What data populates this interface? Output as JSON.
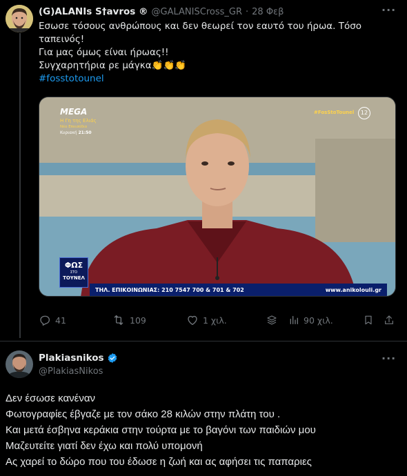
{
  "tweet1": {
    "author_name": "(G)ALANIs S†avros ®",
    "handle": "@GALANISCross_GR",
    "separator": "·",
    "date": "28 Φεβ",
    "more_label": "···",
    "lines": [
      "Εσωσε τόσους ανθρώπους και δεν θεωρεί τον εαυτό του ήρωα. Τόσο",
      "ταπεινός!",
      "Για μας όμως είναι ήρωας!!",
      "Συγχαρητήρια ρε μάγκα"
    ],
    "emoji": "👏👏👏",
    "hashtag": "#fosstotounel",
    "media": {
      "channel": "MEGA",
      "show_title": "Η Γη της Ελιάς",
      "show_subtitle": "Νέο Επεισόδιο",
      "show_time_label": "Κυριακή",
      "show_time": "21:50",
      "tag": "#FosStoTounel",
      "age_rating": "12",
      "logo_line1": "ΦΩΣ",
      "logo_line2": "ΣΤΟ",
      "logo_line3": "ΤΟΥΝΕΛ",
      "ticker_phone": "ΤΗΛ. ΕΠΙΚΟΙΝΩΝΙΑΣ: 210 7547 700 & 701 & 702",
      "ticker_site": "www.anikolouli.gr"
    },
    "actions": {
      "replies": "41",
      "retweets": "109",
      "likes": "1 χιλ.",
      "views": "90 χιλ."
    }
  },
  "tweet2": {
    "author_name": "Plakiasnikos",
    "handle": "@PlakiasNikos",
    "more_label": "···",
    "lines": [
      "Δεν έσωσε κανέναν",
      "Φωτογραφίες έβγαζε με τον σάκο 28 κιλών στην πλάτη του .",
      "Και μετά έσβηνα κεράκια στην τούρτα με το βαγόνι των παιδιών μου",
      "Μαζευτείτε γιατί δεν έχω και πολύ υπομονή",
      "Ας χαρεί το δώρο που του έδωσε η ζωή και ας αφήσει τις παπαριες"
    ]
  },
  "colors": {
    "background": "#000000",
    "text": "#e7e9ea",
    "muted": "#71767b",
    "link": "#1d9bf0",
    "verified": "#1d9bf0",
    "divider": "#2f3336"
  }
}
